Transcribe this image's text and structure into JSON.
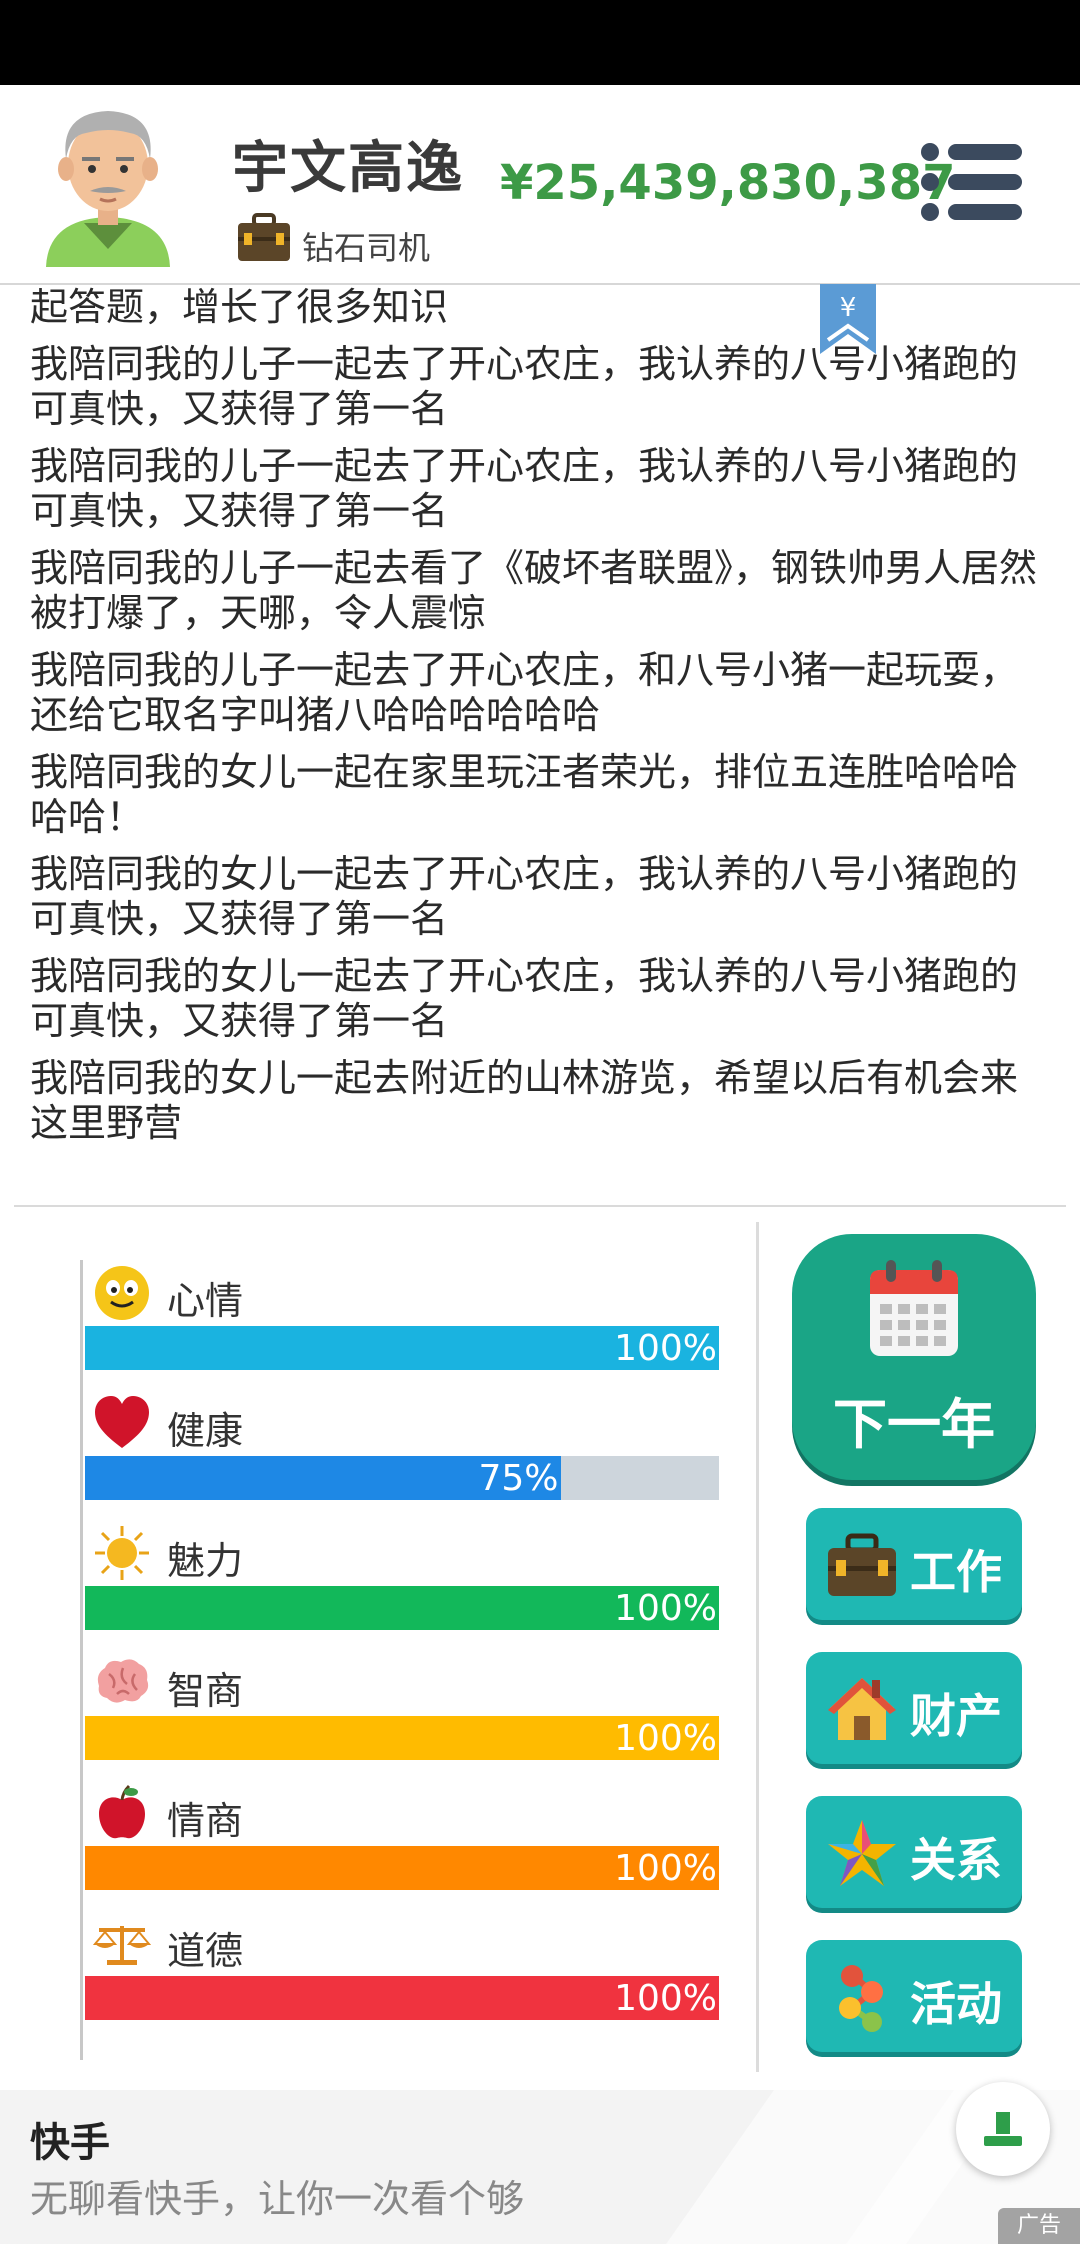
{
  "header": {
    "name": "宇文高逸",
    "job": "钻石司机",
    "money": "¥25,439,830,387"
  },
  "log": [
    "起答题，增长了很多知识",
    "我陪同我的儿子一起去了开心农庄，我认养的八号小猪跑的可真快，又获得了第一名",
    "我陪同我的儿子一起去了开心农庄，我认养的八号小猪跑的可真快，又获得了第一名",
    "我陪同我的儿子一起去看了《破坏者联盟》，钢铁帅男人居然被打爆了，天哪，令人震惊",
    "我陪同我的儿子一起去了开心农庄，和八号小猪一起玩耍，还给它取名字叫猪八哈哈哈哈哈哈",
    "我陪同我的女儿一起在家里玩汪者荣光，排位五连胜哈哈哈哈哈！",
    "我陪同我的女儿一起去了开心农庄，我认养的八号小猪跑的可真快，又获得了第一名",
    "我陪同我的女儿一起去了开心农庄，我认养的八号小猪跑的可真快，又获得了第一名",
    "我陪同我的女儿一起去附近的山林游览，希望以后有机会来这里野营"
  ],
  "stats": [
    {
      "label": "心情",
      "value": "100%",
      "fraction": 1.0,
      "color": "#1ab3e0",
      "icon": "smiley-icon"
    },
    {
      "label": "健康",
      "value": "75%",
      "fraction": 0.75,
      "color": "#1e88e5",
      "icon": "heart-icon"
    },
    {
      "label": "魅力",
      "value": "100%",
      "fraction": 1.0,
      "color": "#12b85a",
      "icon": "sun-icon"
    },
    {
      "label": "智商",
      "value": "100%",
      "fraction": 1.0,
      "color": "#ffbb00",
      "icon": "brain-icon"
    },
    {
      "label": "情商",
      "value": "100%",
      "fraction": 1.0,
      "color": "#ff8800",
      "icon": "apple-icon"
    },
    {
      "label": "道德",
      "value": "100%",
      "fraction": 1.0,
      "color": "#f0333f",
      "icon": "scales-icon"
    }
  ],
  "actions": {
    "next_year": "下一年",
    "work": "工作",
    "property": "财产",
    "relations": "关系",
    "activity": "活动"
  },
  "ad": {
    "title": "快手",
    "subtitle": "无聊看快手，让你一次看个够",
    "tag": "广告"
  },
  "colors": {
    "money": "#3d9a46",
    "primary_button": "#1aa586",
    "secondary_button": "#1fb8b3"
  }
}
